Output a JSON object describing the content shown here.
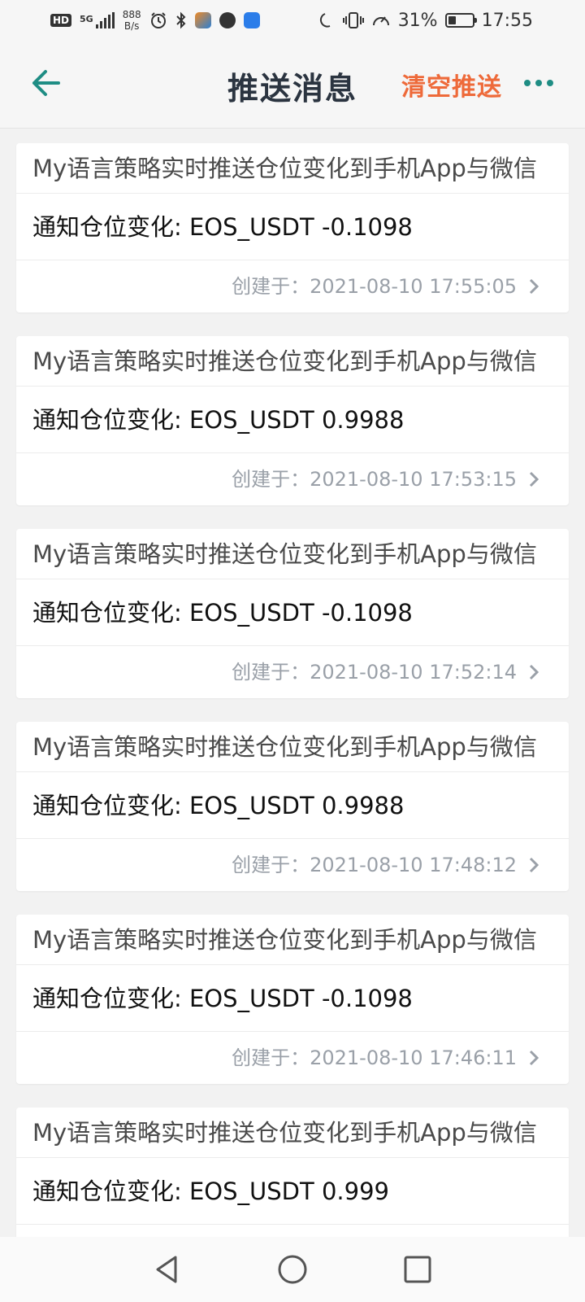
{
  "status_bar": {
    "hd": "HD",
    "network": "5G",
    "net_speed_value": "888",
    "net_speed_unit": "B/s",
    "battery_percent": "31%",
    "battery_level": 0.31,
    "time": "17:55",
    "icons": [
      "alarm-icon",
      "bluetooth-icon",
      "app-icon-1",
      "app-icon-2",
      "app-icon-3",
      "moon-icon",
      "vibrate-icon",
      "speed-icon"
    ]
  },
  "header": {
    "title": "推送消息",
    "clear_label": "清空推送",
    "back_icon": "arrow-left-icon",
    "more_icon": "more-dots-icon",
    "accent_color": "#1f8d84",
    "clear_color": "#ee6a3a"
  },
  "messages": [
    {
      "title": "My语言策略实时推送仓位变化到手机App与微信",
      "body": "通知仓位变化: EOS_USDT -0.1098",
      "time": "创建于：2021-08-10 17:55:05"
    },
    {
      "title": "My语言策略实时推送仓位变化到手机App与微信",
      "body": "通知仓位变化: EOS_USDT 0.9988",
      "time": "创建于：2021-08-10 17:53:15"
    },
    {
      "title": "My语言策略实时推送仓位变化到手机App与微信",
      "body": "通知仓位变化: EOS_USDT -0.1098",
      "time": "创建于：2021-08-10 17:52:14"
    },
    {
      "title": "My语言策略实时推送仓位变化到手机App与微信",
      "body": "通知仓位变化: EOS_USDT 0.9988",
      "time": "创建于：2021-08-10 17:48:12"
    },
    {
      "title": "My语言策略实时推送仓位变化到手机App与微信",
      "body": "通知仓位变化: EOS_USDT -0.1098",
      "time": "创建于：2021-08-10 17:46:11"
    },
    {
      "title": "My语言策略实时推送仓位变化到手机App与微信",
      "body": "通知仓位变化: EOS_USDT 0.999",
      "time": ""
    }
  ],
  "nav_bar": {
    "buttons": [
      "back-triangle-icon",
      "home-circle-icon",
      "recents-square-icon"
    ]
  }
}
